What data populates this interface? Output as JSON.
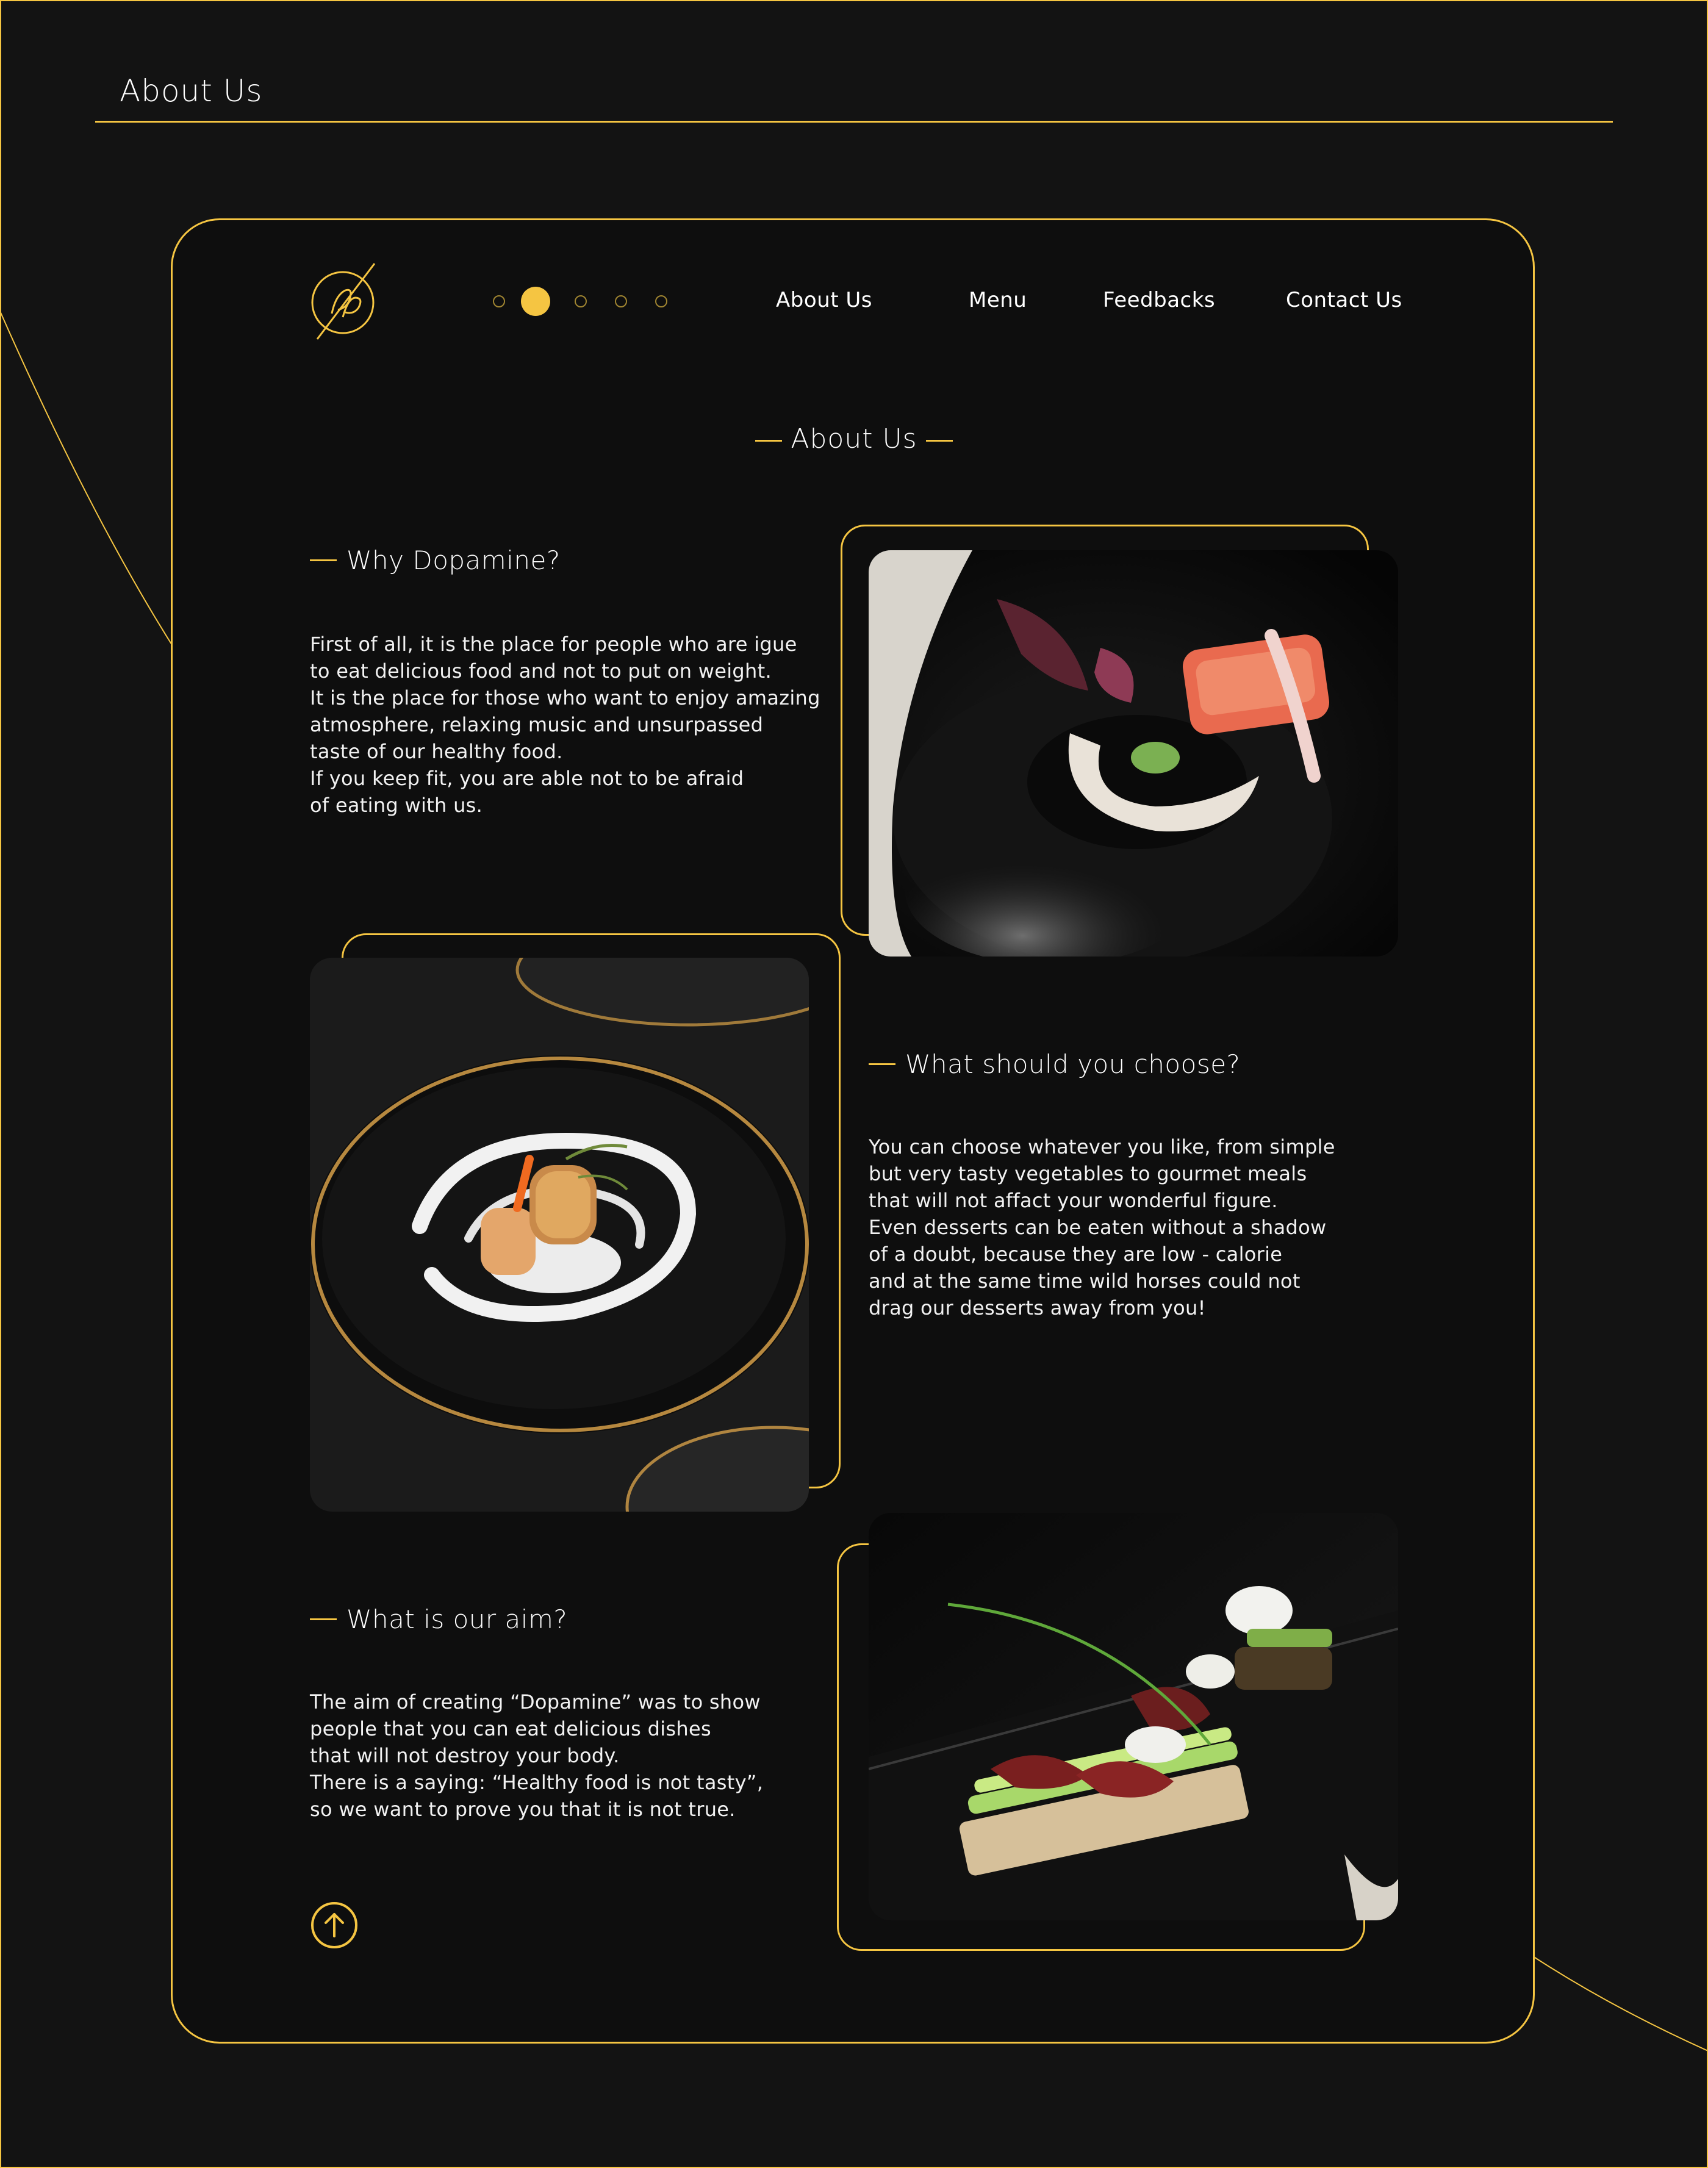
{
  "page": {
    "heading": "About Us"
  },
  "colors": {
    "accent": "#f5c542",
    "background": "#131313",
    "card": "#0e0e0e",
    "text": "#ffffff"
  },
  "header": {
    "logo_icon": "dp-monogram-logo",
    "carousel": {
      "slide_count": 5,
      "active_index": 1
    },
    "nav": [
      {
        "label": "About Us"
      },
      {
        "label": "Menu"
      },
      {
        "label": "Feedbacks"
      },
      {
        "label": "Contact Us"
      }
    ]
  },
  "main": {
    "title": "About Us",
    "sections": [
      {
        "heading": "Why Dopamine?",
        "lines": [
          "First of all, it is the place for people who are igue",
          "to eat delicious food and not to put on weight.",
          "It is the place for those who want to enjoy amazing",
          "atmosphere, relaxing music and unsurpassed",
          "taste of our healthy food.",
          "If you keep fit, you are able not to be afraid",
          "of eating with us."
        ]
      },
      {
        "heading": "What should you choose?",
        "lines": [
          "You can choose whatever you like, from simple",
          "but very tasty vegetables to gourmet meals",
          "that will not affact your wonderful figure.",
          "Even desserts can be eaten without a shadow",
          "of a doubt, because they are low - calorie",
          "and at the same time wild horses could not",
          "drag our desserts away from you!"
        ]
      },
      {
        "heading": "What is our aim?",
        "lines": [
          "The aim of creating “Dopamine” was to show",
          "people that you can eat delicious dishes",
          "that will not destroy your body.",
          "There is a saying: “Healthy food is not tasty”,",
          "so we want to prove you that it is not true."
        ]
      }
    ]
  },
  "footer": {
    "scroll_up_icon": "arrow-up-circle-icon"
  }
}
